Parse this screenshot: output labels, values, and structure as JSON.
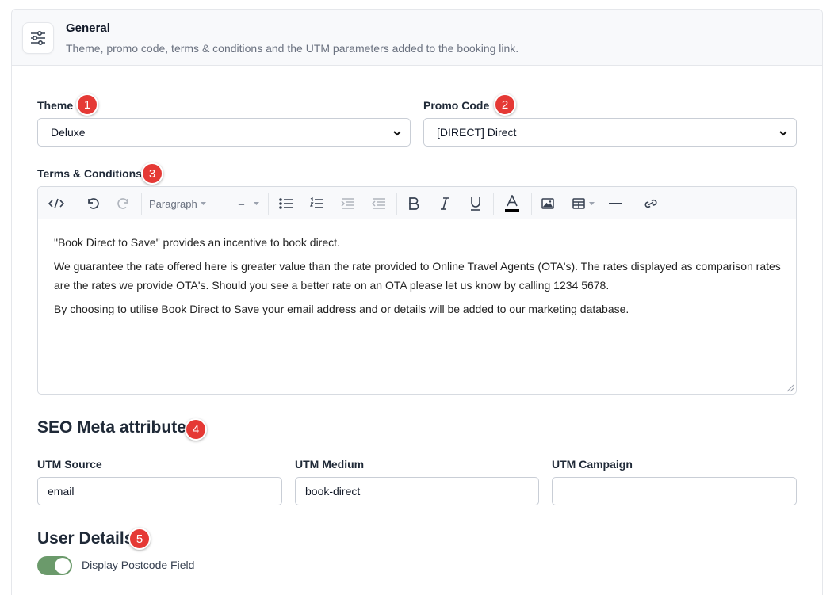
{
  "header": {
    "title": "General",
    "description": "Theme, promo code, terms & conditions and the UTM parameters added to the booking link.",
    "icon": "sliders-icon"
  },
  "theme": {
    "label": "Theme",
    "badge": "1",
    "value": "Deluxe"
  },
  "promo": {
    "label": "Promo Code",
    "badge": "2",
    "value": "[DIRECT] Direct"
  },
  "terms": {
    "label": "Terms & Conditions",
    "badge": "3",
    "toolbar": {
      "block_format": "Paragraph",
      "font_size": "–"
    },
    "paragraphs": [
      "\"Book Direct to Save\" provides an incentive to book direct.",
      "We guarantee the rate offered here is greater value than the rate provided to Online Travel Agents (OTA's). The rates displayed as comparison rates are the rates we provide OTA's. Should you see a better rate on an OTA please let us know by calling 1234 5678.",
      "By choosing to utilise Book Direct to Save your email address and or details will be added to our marketing database."
    ]
  },
  "seo": {
    "title": "SEO Meta attributes",
    "badge": "4",
    "utm_source": {
      "label": "UTM Source",
      "value": "email"
    },
    "utm_medium": {
      "label": "UTM Medium",
      "value": "book-direct"
    },
    "utm_campaign": {
      "label": "UTM Campaign",
      "value": ""
    }
  },
  "user_details": {
    "title": "User Details",
    "badge": "5",
    "postcode_toggle": {
      "label": "Display Postcode Field",
      "on": true
    }
  },
  "colors": {
    "badge": "#e53935",
    "toggle_on": "#6b9a6b",
    "text_color_bar": "#000000"
  }
}
